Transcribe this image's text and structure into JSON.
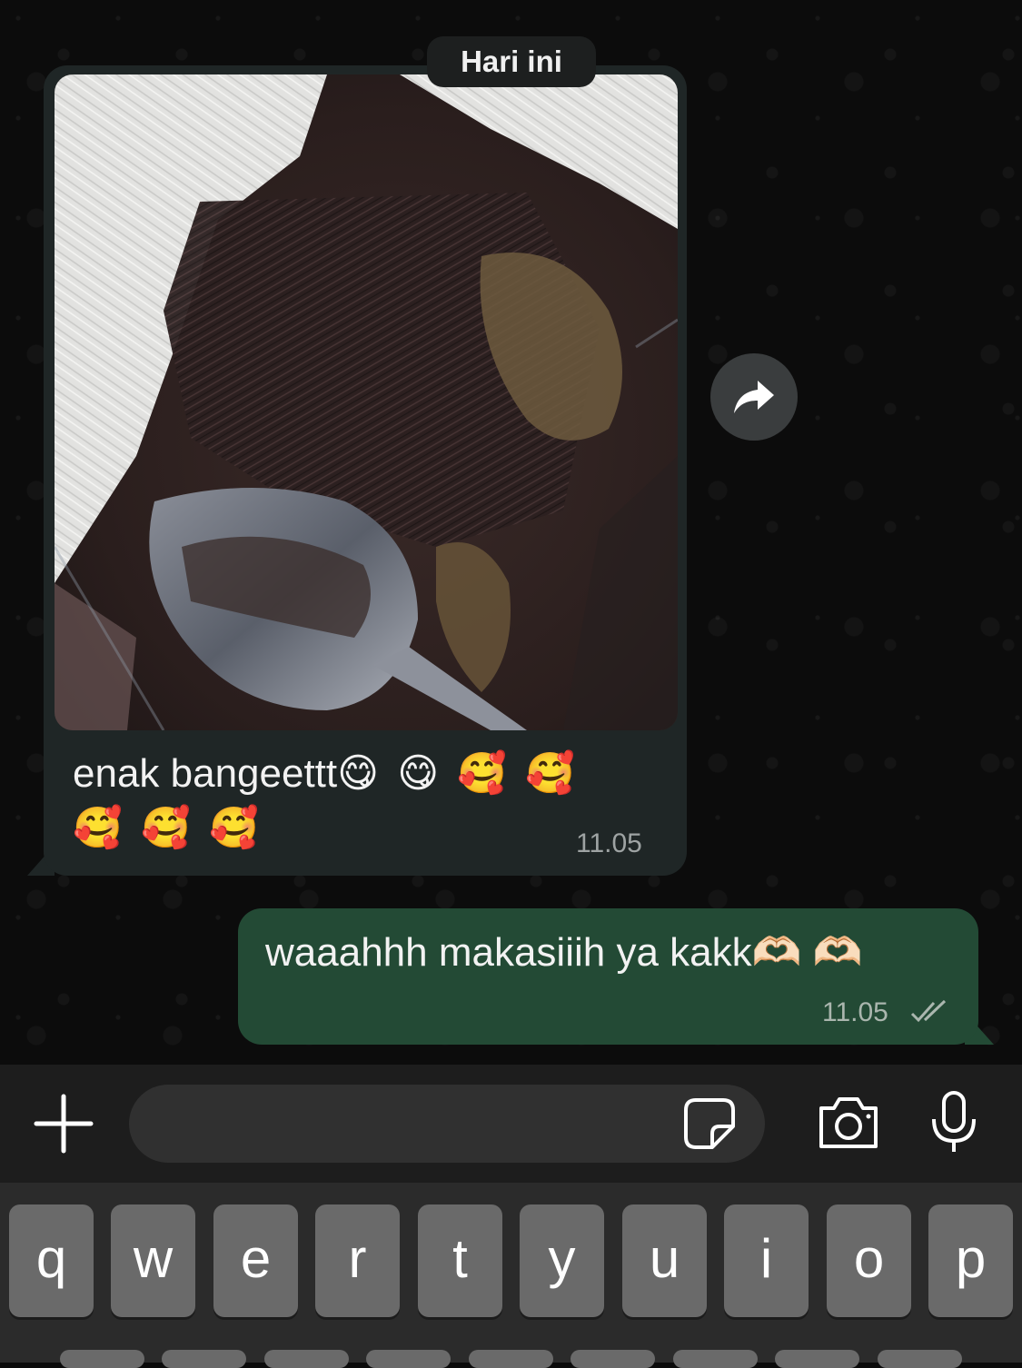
{
  "chat": {
    "date_separator": "Hari ini",
    "incoming": {
      "text": "enak bangeettt",
      "emoji_line1": "😋 😋 🥰 🥰",
      "emoji_line2": "🥰 🥰 🥰",
      "time": "11.05"
    },
    "outgoing": {
      "text": "waaahhh makasiiih ya kakk",
      "emoji": "🫶🏻 🫶🏻",
      "time": "11.05",
      "status": "read"
    }
  },
  "composer": {
    "placeholder": "",
    "icons": [
      "plus-icon",
      "sticker-icon",
      "camera-icon",
      "microphone-icon"
    ]
  },
  "keyboard": {
    "row1": [
      "q",
      "w",
      "e",
      "r",
      "t",
      "y",
      "u",
      "i",
      "o",
      "p"
    ]
  },
  "colors": {
    "incoming_bubble": "#1f2626",
    "outgoing_bubble": "#234a35",
    "timestamp": "#9ea3a3",
    "key": "#6a6a6a"
  }
}
